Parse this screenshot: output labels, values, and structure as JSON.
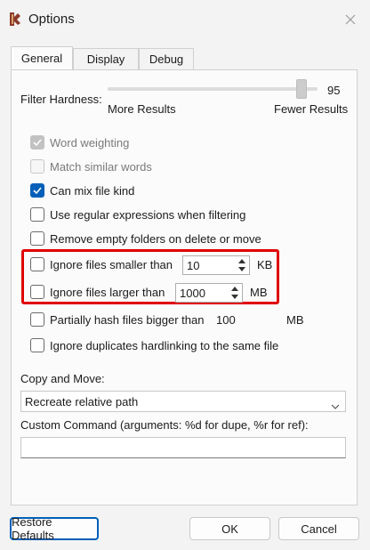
{
  "window": {
    "title": "Options",
    "app_icon": "app-icon",
    "close_icon": "close-icon"
  },
  "tabs": [
    {
      "label": "General",
      "active": true
    },
    {
      "label": "Display",
      "active": false
    },
    {
      "label": "Debug",
      "active": false
    }
  ],
  "filter_hardness": {
    "label": "Filter Hardness:",
    "value": "95",
    "min_label": "More Results",
    "max_label": "Fewer Results",
    "level_fraction": 0.95
  },
  "options": {
    "word_weighting": {
      "label": "Word weighting",
      "checked": true,
      "enabled": false
    },
    "match_similar": {
      "label": "Match similar words",
      "checked": false,
      "enabled": false
    },
    "mix_file_kind": {
      "label": "Can mix file kind",
      "checked": true,
      "enabled": true
    },
    "regex": {
      "label": "Use regular expressions when filtering",
      "checked": false,
      "enabled": true
    },
    "remove_empty": {
      "label": "Remove empty folders on delete or move",
      "checked": false,
      "enabled": true
    },
    "ignore_smaller": {
      "label": "Ignore files smaller than",
      "checked": false,
      "value": "10",
      "unit": "KB"
    },
    "ignore_larger": {
      "label": "Ignore files larger than",
      "checked": false,
      "value": "1000",
      "unit": "MB"
    },
    "partial_hash": {
      "label": "Partially hash files bigger than",
      "checked": false,
      "value": "100",
      "unit": "MB"
    },
    "ignore_hardlinks": {
      "label": "Ignore duplicates hardlinking to the same file",
      "checked": false
    }
  },
  "copy_move": {
    "label": "Copy and Move:",
    "selected": "Recreate relative path"
  },
  "custom_command": {
    "label": "Custom Command (arguments: %d for dupe, %r for ref):",
    "value": ""
  },
  "buttons": {
    "restore": "Restore Defaults",
    "ok": "OK",
    "cancel": "Cancel"
  },
  "colors": {
    "accent": "#005fb8",
    "highlight": "#e00000"
  }
}
